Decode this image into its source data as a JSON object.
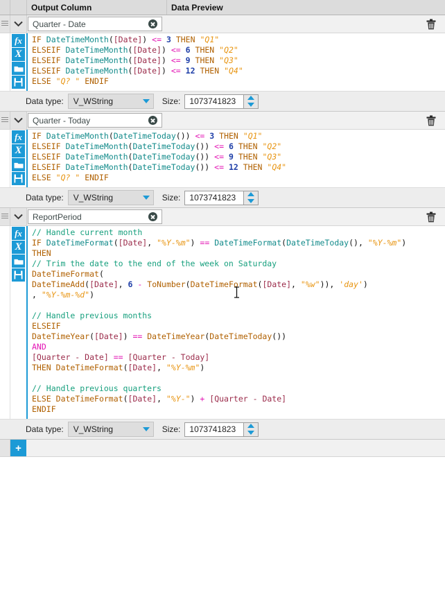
{
  "header": {
    "output_column_label": "Output Column",
    "data_preview_label": "Data Preview"
  },
  "icons": {
    "grip": "drag-handle-icon",
    "chevron": "chevron-down-icon",
    "fx": "fx",
    "clear": "X",
    "open": "open-folder-icon",
    "save": "save-disk-icon",
    "trash": "trash-icon",
    "clear_field": "clear-field-icon",
    "add": "+"
  },
  "common": {
    "data_type_label": "Data type:",
    "data_type_value": "V_WString",
    "size_label": "Size:",
    "size_value": "1073741823"
  },
  "colors": {
    "accent": "#1c9ad6",
    "keyword": "#b06000",
    "function": "#118a8a",
    "operator": "#e317b5",
    "number": "#1f3fa8",
    "string": "#e89512",
    "field": "#9b2b4a",
    "comment": "#17a07e"
  },
  "blocks": [
    {
      "name": "Quarter - Date",
      "data_type": "V_WString",
      "size": "1073741823",
      "expression": "IF DateTimeMonth([Date]) <= 3 THEN \"Q1\"\nELSEIF DateTimeMonth([Date]) <= 6 THEN \"Q2\"\nELSEIF DateTimeMonth([Date]) <= 9 THEN \"Q3\"\nELSEIF DateTimeMonth([Date]) <= 12 THEN \"Q4\"\nELSE \"Q? \" ENDIF"
    },
    {
      "name": "Quarter - Today",
      "data_type": "V_WString",
      "size": "1073741823",
      "expression": "IF DateTimeMonth(DateTimeToday()) <= 3 THEN \"Q1\"\nELSEIF DateTimeMonth(DateTimeToday()) <= 6 THEN \"Q2\"\nELSEIF DateTimeMonth(DateTimeToday()) <= 9 THEN \"Q3\"\nELSEIF DateTimeMonth(DateTimeToday()) <= 12 THEN \"Q4\"\nELSE \"Q? \" ENDIF"
    },
    {
      "name": "ReportPeriod",
      "data_type": "V_WString",
      "size": "1073741823",
      "expression": "// Handle current month\nIF DateTimeFormat([Date], \"%Y-%m\") == DateTimeFormat(DateTimeToday(), \"%Y-%m\")\nTHEN\n// Trim the date to the end of the week on Saturday\nDateTimeFormat(\nDateTimeAdd([Date], 6 - ToNumber(DateTimeFormat([Date], \"%w\")), 'day')\n, \"%Y-%m-%d\")\n\n// Handle previous months\nELSEIF\nDateTimeYear([Date]) == DateTimeYear(DateTimeToday())\nAND\n[Quarter - Date] == [Quarter - Today]\nTHEN DateTimeFormat([Date], \"%Y-%m\")\n\n// Handle previous quarters\nELSE DateTimeFormat([Date], \"%Y-\") + [Quarter - Date]\nENDIF"
    }
  ]
}
